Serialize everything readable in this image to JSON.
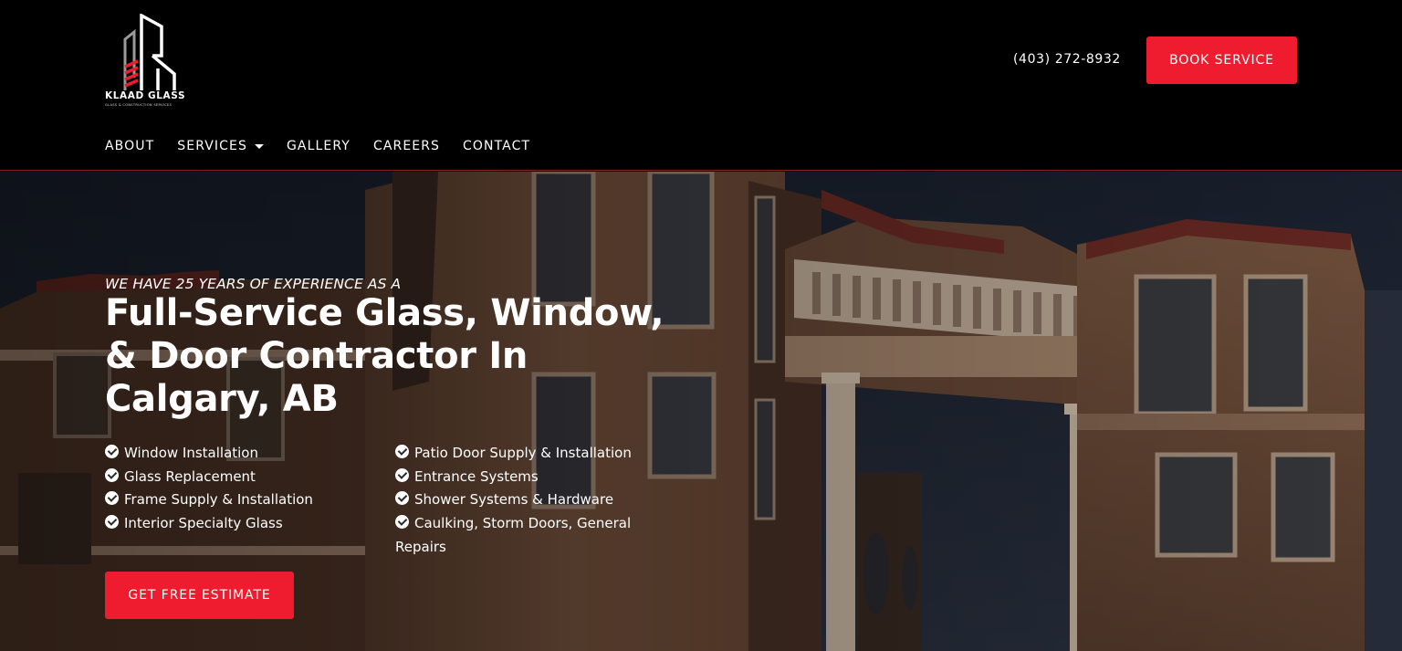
{
  "brand": {
    "name": "KLAAD GLASS",
    "tagline": "GLASS & CONSTRUCTION SERVICES",
    "accent_color": "#ee1c2e"
  },
  "header": {
    "phone": "(403) 272-8932",
    "book_button": "BOOK SERVICE"
  },
  "nav": {
    "items": [
      {
        "label": "ABOUT"
      },
      {
        "label": "SERVICES",
        "icon": "caret-down-icon"
      },
      {
        "label": "GALLERY"
      },
      {
        "label": "CAREERS"
      },
      {
        "label": "CONTACT"
      }
    ]
  },
  "hero": {
    "eyebrow": "WE HAVE 25 YEARS OF EXPERIENCE AS A",
    "headline": "Full-Service Glass, Window, & Door Contractor In Calgary, AB",
    "services_left": [
      "Window Installation",
      "Glass Replacement",
      "Frame Supply & Installation",
      "Interior Specialty Glass"
    ],
    "services_right": [
      "Patio Door Supply & Installation",
      "Entrance Systems",
      "Shower Systems & Hardware",
      "Caulking, Storm Doors, General Repairs"
    ],
    "cta_button": "GET FREE ESTIMATE",
    "check_icon": "check-circle-icon"
  }
}
